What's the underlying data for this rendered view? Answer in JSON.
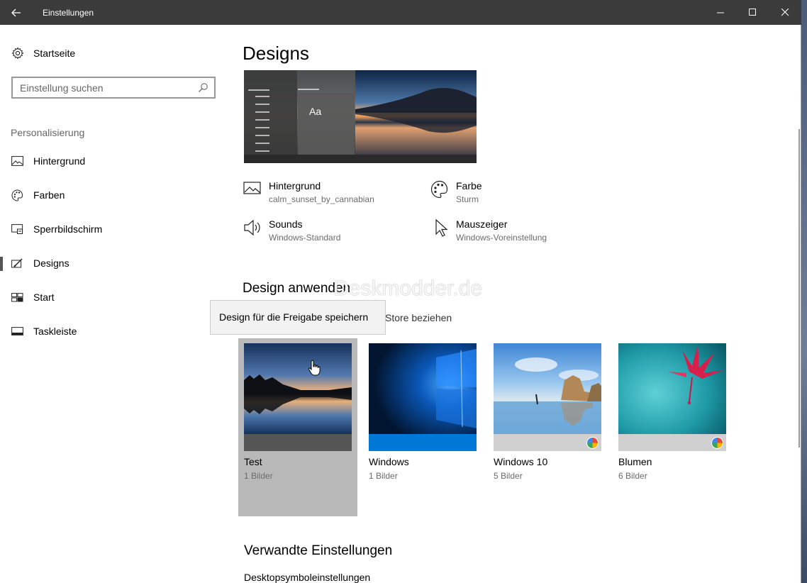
{
  "window": {
    "title": "Einstellungen"
  },
  "sidebar": {
    "home_label": "Startseite",
    "search_placeholder": "Einstellung suchen",
    "group_label": "Personalisierung",
    "items": [
      {
        "label": "Hintergrund",
        "icon": "picture-icon"
      },
      {
        "label": "Farben",
        "icon": "palette-icon"
      },
      {
        "label": "Sperrbildschirm",
        "icon": "lock-screen-icon"
      },
      {
        "label": "Designs",
        "icon": "designs-icon",
        "active": true
      },
      {
        "label": "Start",
        "icon": "start-icon"
      },
      {
        "label": "Taskleiste",
        "icon": "taskbar-icon"
      }
    ]
  },
  "main": {
    "title": "Designs",
    "preview_text": "Aa",
    "attributes": [
      {
        "label": "Hintergrund",
        "value": "calm_sunset_by_cannabian",
        "icon": "picture-icon"
      },
      {
        "label": "Farbe",
        "value": "Sturm",
        "icon": "palette-icon"
      },
      {
        "label": "Sounds",
        "value": "Windows-Standard",
        "icon": "speaker-icon"
      },
      {
        "label": "Mauszeiger",
        "value": "Windows-Voreinstellung",
        "icon": "pointer-icon"
      }
    ],
    "apply_heading": "Design anwenden",
    "watermark": "Deskmodder.de",
    "tooltip": "Design für die Freigabe speichern",
    "store_link": "Store beziehen",
    "themes": [
      {
        "name": "Test",
        "count": "1 Bilder",
        "selected": true
      },
      {
        "name": "Windows",
        "count": "1 Bilder"
      },
      {
        "name": "Windows 10",
        "count": "5 Bilder",
        "multicolor": true
      },
      {
        "name": "Blumen",
        "count": "6 Bilder",
        "multicolor": true
      }
    ],
    "related_heading": "Verwandte Einstellungen",
    "related_links": [
      "Desktopsymboleinstellungen"
    ]
  },
  "colors": {
    "titlebar": "#3b3b3b",
    "windows_blue": "#0078d7",
    "selected_tile": "#b9b9b9"
  }
}
